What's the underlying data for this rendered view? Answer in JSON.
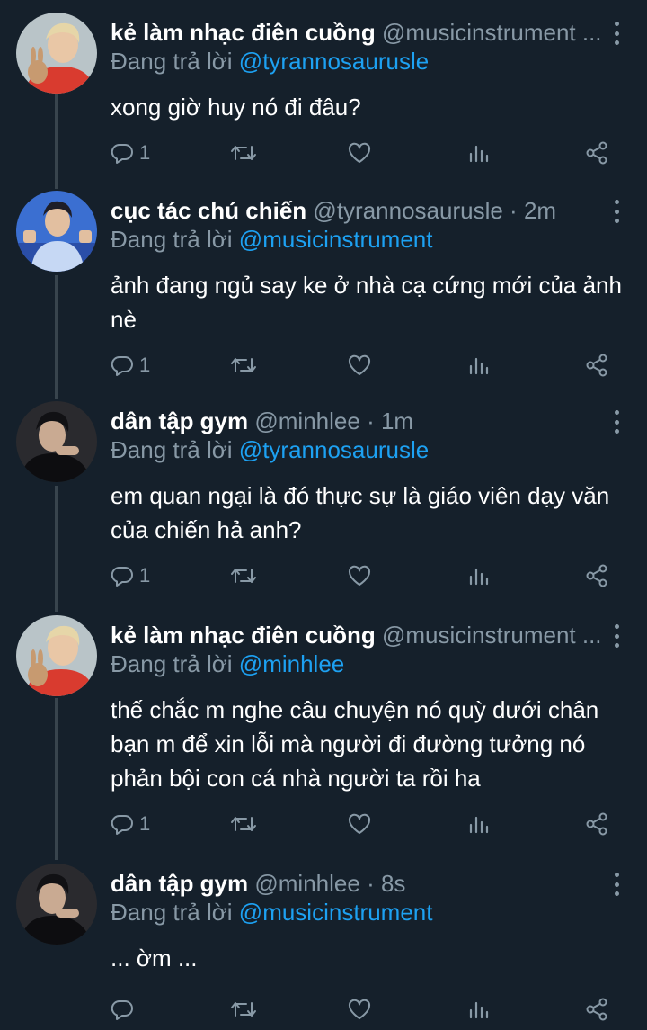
{
  "colors": {
    "background": "#15202b",
    "secondary_text": "#8899a6",
    "mention": "#1da1f2",
    "thread_line": "#38444d"
  },
  "reply_prefix": "Đang trả lời",
  "tweets": [
    {
      "display_name": "kẻ làm nhạc điên cuồng",
      "handle": "@musicinstrument ...",
      "time": "",
      "reply_to": "@tyrannosaurusle",
      "lines": [
        "xong giờ huy nó đi đâu?"
      ],
      "reply_count": "1",
      "avatar": "avatar-red-sweater-rabbit"
    },
    {
      "display_name": "cục tác chú chiến",
      "handle": "@tyrannosaurusle",
      "time": "2m",
      "reply_to": "@musicinstrument",
      "lines": [
        "ảnh đang ngủ say ke ở nhà cạ cứng mới của ảnh",
        "nè"
      ],
      "reply_count": "1",
      "avatar": "avatar-blue-stage"
    },
    {
      "display_name": "dân tập gym",
      "handle": "@minhlee",
      "time": "1m",
      "reply_to": "@tyrannosaurusle",
      "lines": [
        "em quan ngại là đó thực sự là giáo viên dạy văn",
        "của chiến hả anh?"
      ],
      "reply_count": "1",
      "avatar": "avatar-dark-portrait"
    },
    {
      "display_name": "kẻ làm nhạc điên cuồng",
      "handle": "@musicinstrument ...",
      "time": "",
      "reply_to": "@minhlee",
      "lines": [
        "thế chắc m nghe câu chuyện nó quỳ dưới chân",
        "bạn m để xin lỗi mà người đi đường tưởng nó",
        "phản bội con cá nhà người ta rồi ha"
      ],
      "reply_count": "1",
      "avatar": "avatar-red-sweater-rabbit"
    },
    {
      "display_name": "dân tập gym",
      "handle": "@minhlee",
      "time": "8s",
      "reply_to": "@musicinstrument",
      "lines": [
        "... ờm ..."
      ],
      "reply_count": "",
      "avatar": "avatar-dark-portrait"
    }
  ],
  "icons": [
    "reply-icon",
    "retweet-icon",
    "like-icon",
    "analytics-icon",
    "share-icon",
    "more-icon"
  ]
}
